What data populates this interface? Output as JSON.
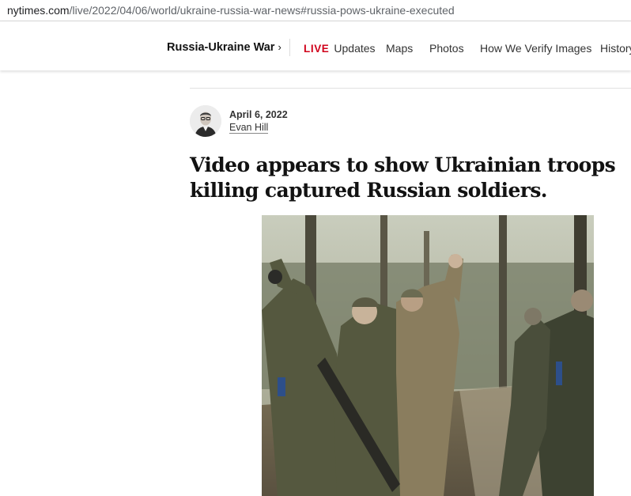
{
  "browser": {
    "url_host": "nytimes.com",
    "url_path": "/live/2022/04/06/world/ukraine-russia-war-news#russia-pows-ukraine-executed"
  },
  "nav": {
    "section_title": "Russia-Ukraine War",
    "chevron": "›",
    "live_label": "LIVE",
    "items": [
      "Updates",
      "Maps",
      "Photos",
      "How We Verify Images",
      "History"
    ]
  },
  "post": {
    "date": "April 6, 2022",
    "author": "Evan Hill",
    "headline": "Video appears to show Ukrainian troops killing captured Russian soldiers."
  },
  "colors": {
    "live_red": "#d0021b",
    "text": "#121212"
  }
}
